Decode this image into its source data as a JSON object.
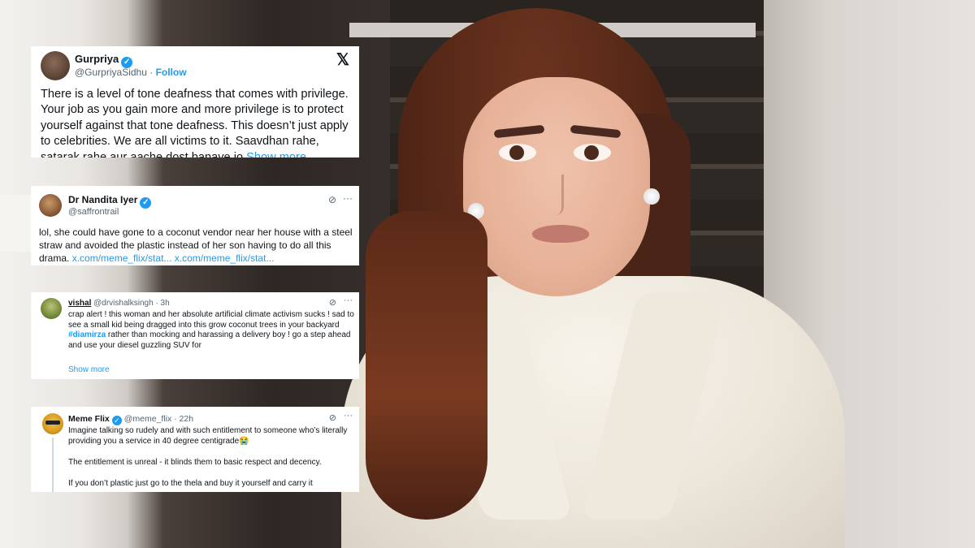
{
  "tweets": [
    {
      "name": "Gurpriya",
      "handle": "@GurpriyaSidhu",
      "separator": "·",
      "follow": "Follow",
      "platform_icon": "x-logo-icon",
      "text": "There is a level of tone deafness that comes with privilege. Your job as you gain more and more privilege is to protect yourself against that tone deafness. This doesn’t just apply to celebrities. We are all victims to it. Saavdhan rahe, satarak rahe aur aache dost banaye jo",
      "show_more": "Show more"
    },
    {
      "name": "Dr Nandita Iyer",
      "handle": "@saffrontrail",
      "text": "lol, she could have gone to a coconut vendor near her house with a steel straw and avoided the plastic instead of her son having to do all this drama.",
      "links": [
        "x.com/meme_flix/stat...",
        "x.com/meme_flix/stat..."
      ]
    },
    {
      "name": "vishal",
      "handle": "@drvishalksingh",
      "time": "· 3h",
      "text_1": "crap alert ! this woman and her absolute artificial climate activism sucks ! sad to see a small kid being dragged into this grow coconut trees in your backyard",
      "hashtag": "#diamirza",
      "text_2": "rather than mocking and harassing a delivery boy ! go a step ahead and use your diesel guzzling SUV for",
      "show_more": "Show more"
    },
    {
      "name": "Meme Flix",
      "handle": "@meme_flix",
      "time": "· 22h",
      "p1": "Imagine talking so rudely and with such entitlement to someone who’s literally providing you a service in 40 degree centigrade😭",
      "p2": "The entitlement is unreal - it blinds them to basic respect and decency.",
      "p3": "If you don’t plastic just go to the thela and buy it yourself and carry it"
    }
  ],
  "icons": {
    "verified": "✓",
    "grok": "⊘",
    "more": "···",
    "x_logo": "𝕏"
  }
}
